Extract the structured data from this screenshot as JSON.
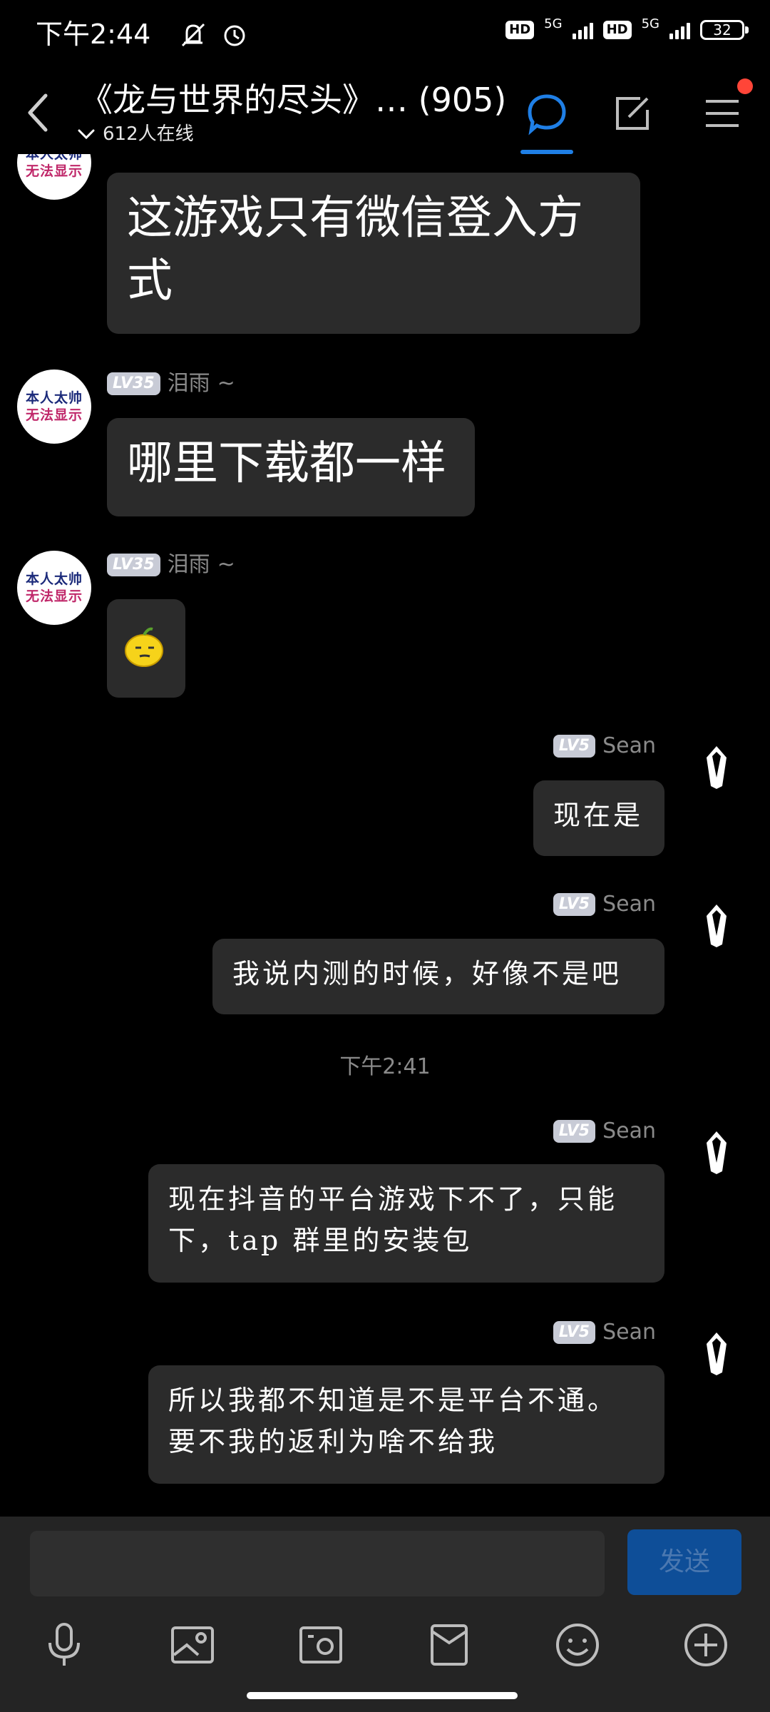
{
  "status_bar": {
    "time": "下午2:44",
    "network_1": "5G",
    "network_2": "5G",
    "battery": "32"
  },
  "header": {
    "title": "《龙与世界的尽头》…  (905)",
    "online": "612人在线"
  },
  "messages": [
    {
      "sender": "",
      "level": "",
      "text": "这游戏只有微信登入方式"
    },
    {
      "sender": "泪雨",
      "level": "LV35",
      "text": "哪里下载都一样"
    },
    {
      "sender": "泪雨",
      "level": "LV35",
      "text": ""
    },
    {
      "sender": "Sean",
      "level": "LV5",
      "text": "现在是"
    },
    {
      "sender": "Sean",
      "level": "LV5",
      "text": "我说内测的时候，好像不是吧"
    },
    {
      "sender": "Sean",
      "level": "LV5",
      "text": "现在抖音的平台游戏下不了，只能下，tap 群里的安装包"
    },
    {
      "sender": "Sean",
      "level": "LV5",
      "text": "所以我都不知道是不是平台不通。要不我的返利为啥不给我"
    }
  ],
  "avatar_text": [
    "本人太帅",
    "无法显示"
  ],
  "time_divider": "下午2:41",
  "input": {
    "placeholder": "",
    "send_label": "发送"
  },
  "colors": {
    "accent": "#1f7fe6",
    "bubble": "#2b2b2b",
    "badge": "#ff4538",
    "send_button": "#0e4e98"
  },
  "icons": [
    "back-icon",
    "chat-icon",
    "edit-icon",
    "menu-icon",
    "voice-icon",
    "image-icon",
    "camera-icon",
    "red-packet-icon",
    "emoji-icon",
    "plus-icon"
  ]
}
